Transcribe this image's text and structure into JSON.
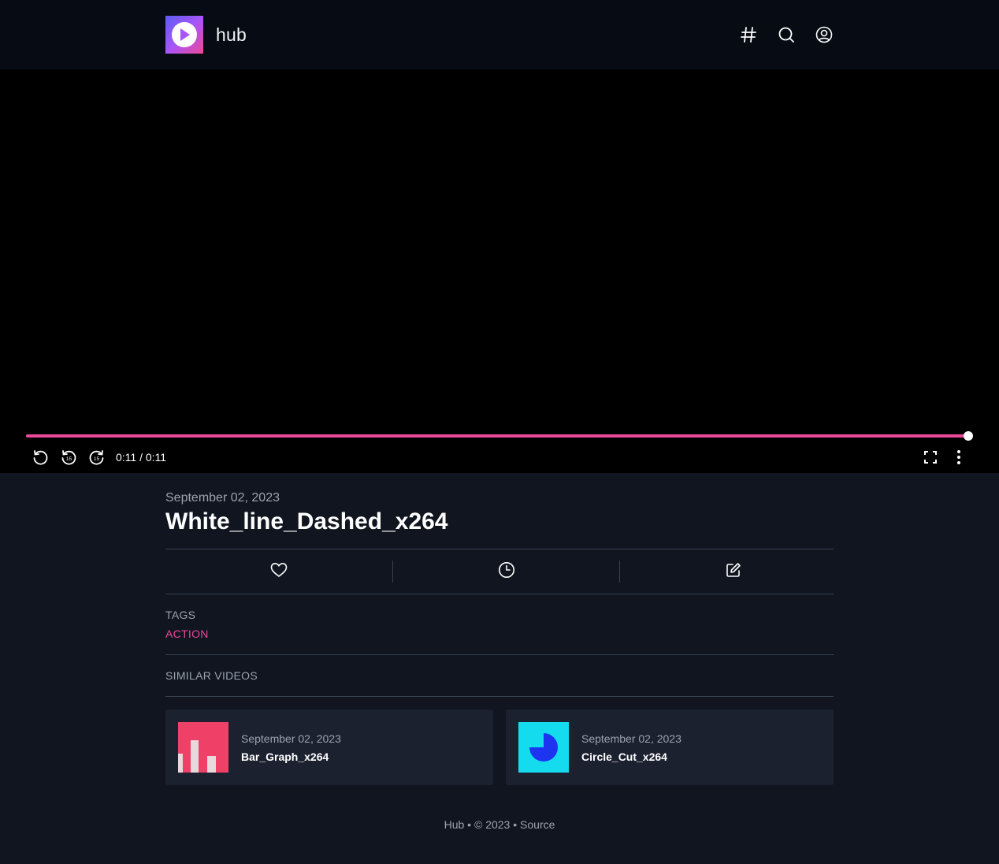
{
  "header": {
    "brand": "hub",
    "icons": [
      "hashtag-icon",
      "search-icon",
      "user-circle-icon"
    ]
  },
  "player": {
    "time_display": "0:11 / 0:11",
    "progress_fraction": 1.0,
    "accent_color": "#ec4899",
    "controls": [
      "replay-icon",
      "rewind-15-icon",
      "forward-15-icon",
      "fullscreen-icon",
      "more-vertical-icon"
    ]
  },
  "video": {
    "date": "September 02, 2023",
    "title": "White_line_Dashed_x264"
  },
  "actions": [
    "heart-icon",
    "clock-icon",
    "edit-icon"
  ],
  "tags": {
    "label": "TAGS",
    "items": [
      "ACTION"
    ]
  },
  "similar": {
    "label": "SIMILAR VIDEOS",
    "items": [
      {
        "date": "September 02, 2023",
        "title": "Bar_Graph_x264",
        "thumb_color": "#ef4168"
      },
      {
        "date": "September 02, 2023",
        "title": "Circle_Cut_x264",
        "thumb_color": "#14dbee"
      }
    ]
  },
  "footer": {
    "hub": "Hub",
    "sep1": " • ",
    "copyright": "© 2023",
    "sep2": " • ",
    "source": "Source"
  }
}
